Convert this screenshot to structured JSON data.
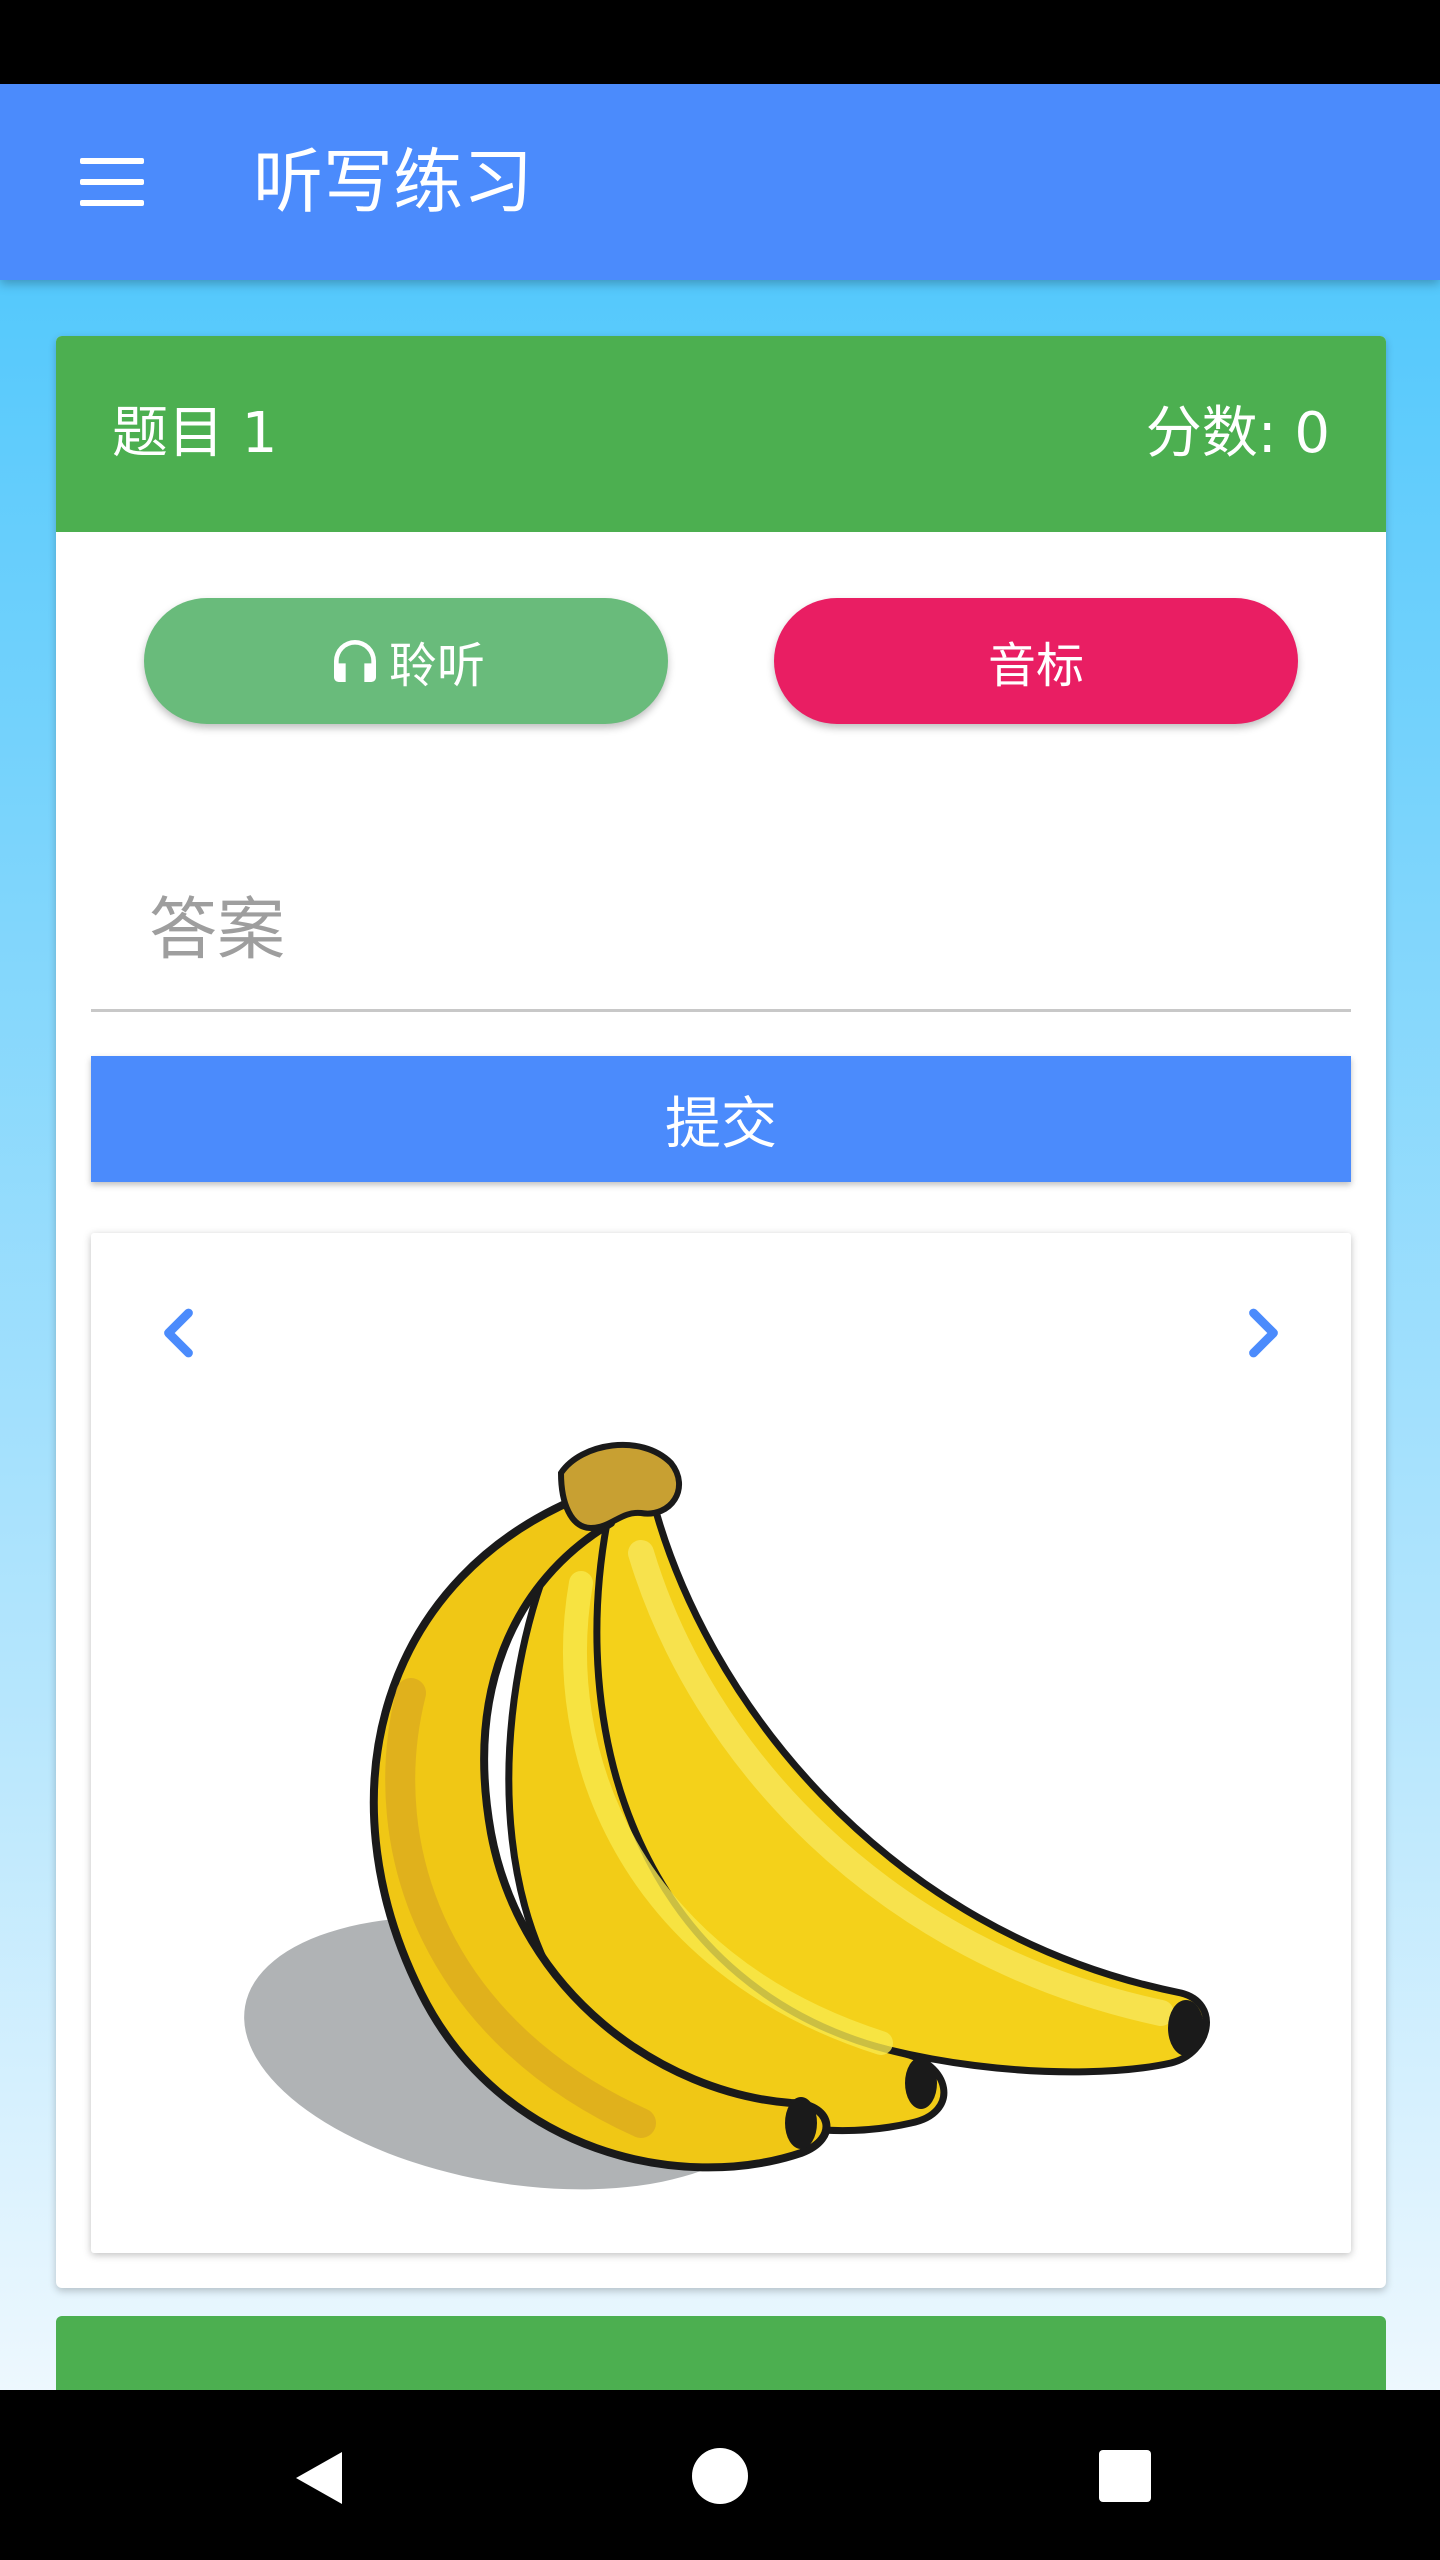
{
  "app_bar": {
    "title": "听写练习",
    "menu_icon": "menu-icon"
  },
  "question": {
    "label": "题目 1",
    "score": "分数: 0"
  },
  "buttons": {
    "listen_label": "聆听",
    "listen_icon": "headphones-icon",
    "phonetic_label": "音标",
    "submit_label": "提交"
  },
  "answer": {
    "placeholder": "答案",
    "value": ""
  },
  "image_card": {
    "image": "banana-illustration",
    "prev_icon": "chevron-left-icon",
    "next_icon": "chevron-right-icon"
  },
  "colors": {
    "app_bar": "#4b8bfc",
    "card_header": "#4caf50",
    "listen_button": "#69bb7b",
    "phonetic_button": "#e91e63",
    "submit_button": "#4b8bfc"
  },
  "system_nav": {
    "back_icon": "back-icon",
    "home_icon": "home-icon",
    "recents_icon": "recents-icon"
  }
}
